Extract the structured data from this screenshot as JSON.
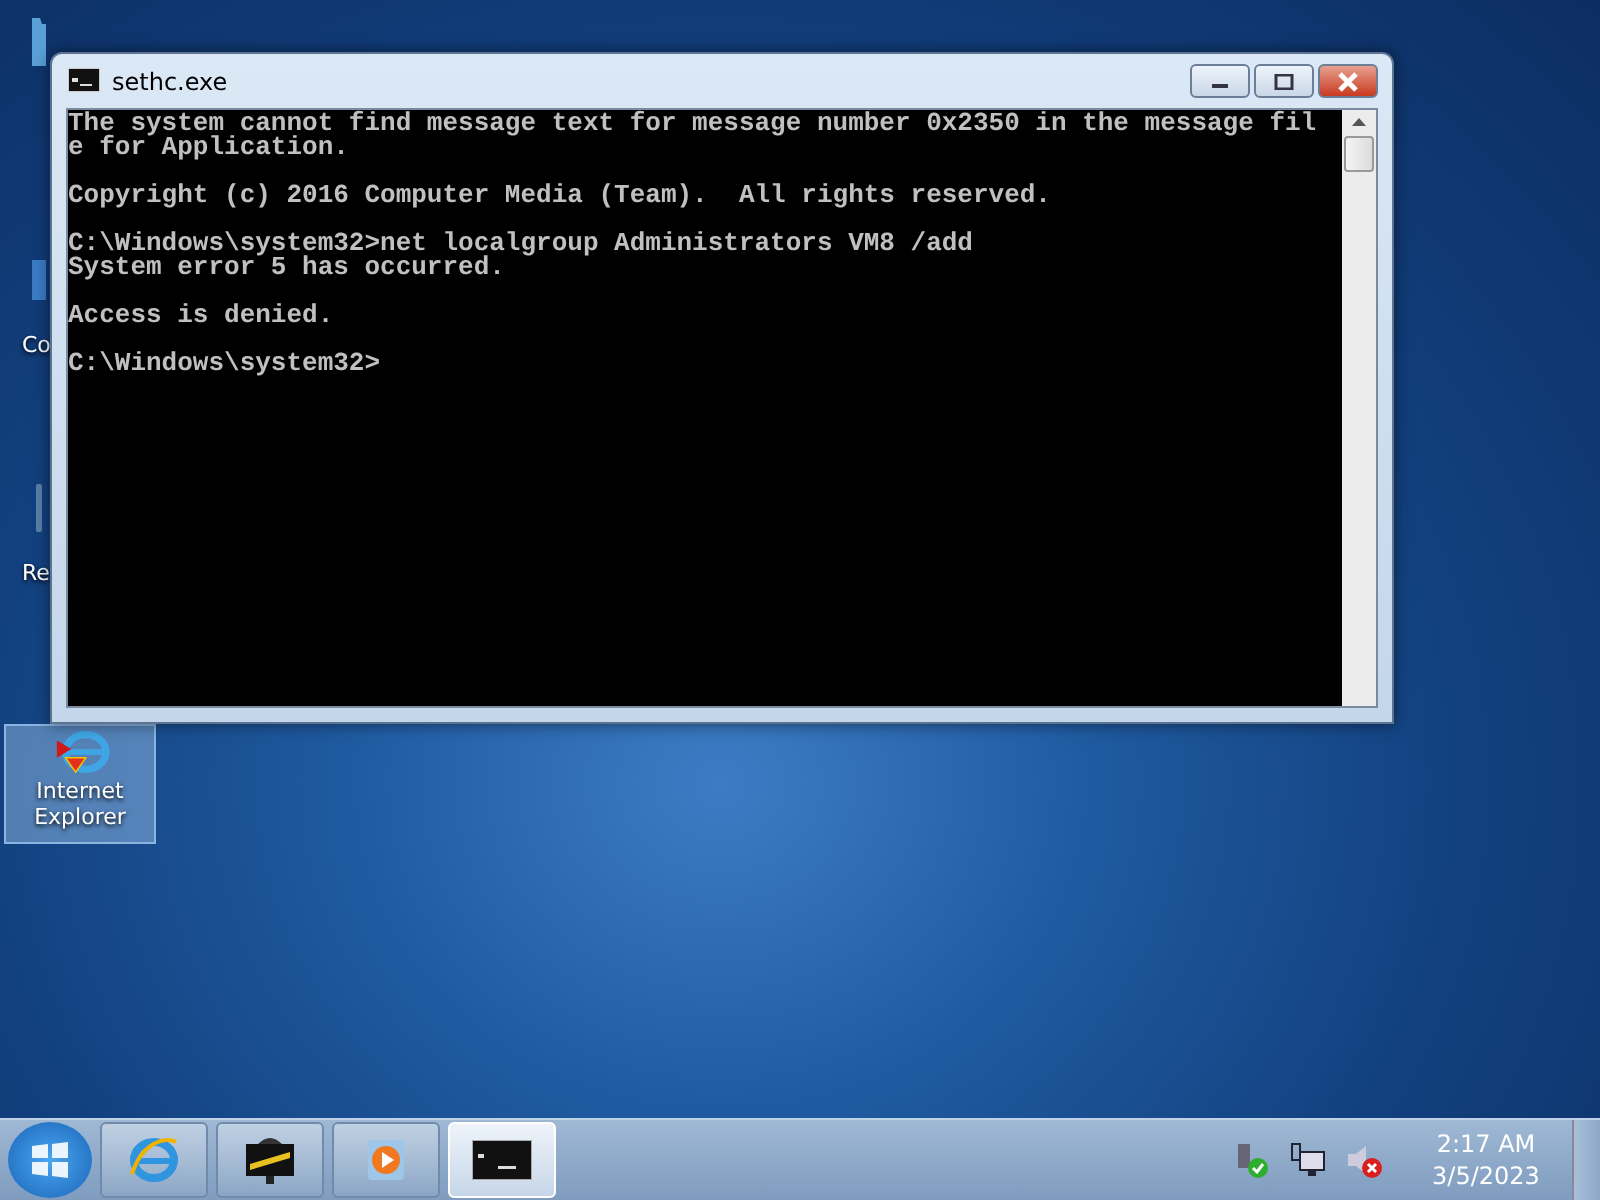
{
  "desktop_icons": [
    {
      "kind": "folder",
      "selected": false
    },
    {
      "kind": "computer",
      "label": "Co",
      "selected": false
    },
    {
      "kind": "recycle",
      "label": "Re",
      "selected": false
    },
    {
      "kind": "browser",
      "label": "Internet Explorer",
      "selected": true
    }
  ],
  "window": {
    "title": "sethc.exe",
    "console": {
      "blocks": [
        [
          "The system cannot find message text for message number 0x2350 in the message fil",
          "e for Application."
        ],
        [
          "Copyright (c) 2016 Computer Media (Team).  All rights reserved."
        ],
        [
          "C:\\Windows\\system32>net localgroup Administrators VM8 /add",
          "System error 5 has occurred."
        ],
        [
          "Access is denied."
        ]
      ],
      "prompt": "C:\\Windows\\system32>"
    }
  },
  "taskbar": {
    "items": [
      {
        "kind": "browser",
        "active": false
      },
      {
        "kind": "media-app",
        "active": false
      },
      {
        "kind": "player",
        "active": false
      },
      {
        "kind": "console",
        "active": true
      }
    ],
    "clock": {
      "time": "2:17 AM",
      "date": "3/5/2023"
    }
  }
}
